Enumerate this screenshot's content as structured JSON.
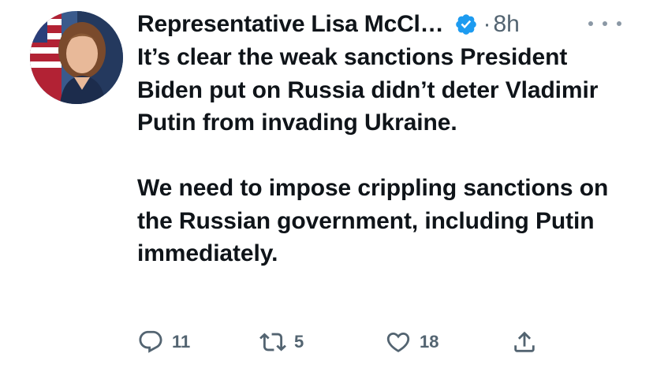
{
  "author": {
    "name": "Representative Lisa McCl…",
    "verified": true,
    "separator": "·",
    "time": "8h"
  },
  "tweet": {
    "paragraph1": "It’s clear the weak sanctions President Biden put on Russia didn’t deter Vladimir Putin from invading Ukraine.",
    "paragraph2": "We need to impose crippling sanctions on the Russian government, including Putin immediately."
  },
  "actions": {
    "reply_count": "11",
    "retweet_count": "5",
    "like_count": "18"
  },
  "icons": {
    "verified": "verified-badge-icon",
    "more": "more-dots-icon",
    "reply": "reply-icon",
    "retweet": "retweet-icon",
    "like": "heart-icon",
    "share": "share-icon"
  },
  "colors": {
    "verified_blue": "#1d9bf0",
    "muted_gray": "#536471",
    "text": "#0f1419"
  }
}
